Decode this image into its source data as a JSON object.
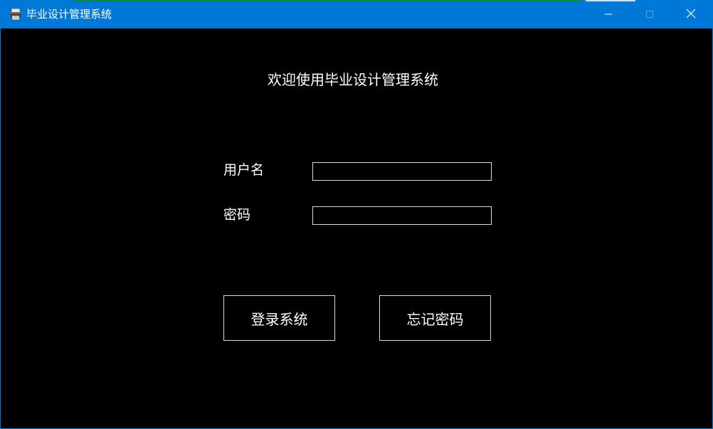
{
  "window": {
    "title": "毕业设计管理系统",
    "app_icon": "printer-app-icon",
    "controls": {
      "minimize_icon": "minimize-icon",
      "maximize_icon": "maximize-icon",
      "close_icon": "close-icon"
    },
    "colors": {
      "titlebar": "#0078d7",
      "background": "#000000",
      "text": "#ffffff",
      "border": "#d9d9d9"
    }
  },
  "form": {
    "heading": "欢迎使用毕业设计管理系统",
    "username_label": "用户名",
    "username_value": "",
    "password_label": "密码",
    "password_value": "",
    "login_button": "登录系统",
    "forgot_button": "忘记密码"
  }
}
